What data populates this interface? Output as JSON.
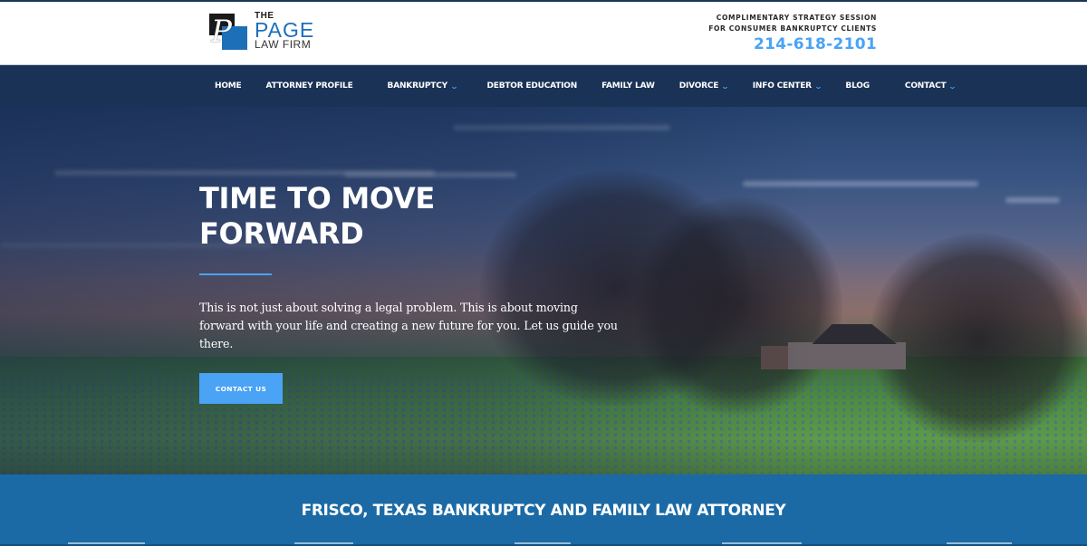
{
  "header": {
    "logo": {
      "the": "THE",
      "page": "PAGE",
      "law_firm": "LAW FIRM",
      "mark_glyph": "P",
      "name": "logo"
    },
    "promo": {
      "line1": "COMPLIMENTARY STRATEGY SESSION",
      "line2": "FOR CONSUMER BANKRUPTCY CLIENTS",
      "phone": "214-618-2101"
    }
  },
  "nav": {
    "items": [
      {
        "label": "HOME",
        "dropdown": false
      },
      {
        "label": "ATTORNEY PROFILE",
        "dropdown": false
      },
      {
        "label": "BANKRUPTCY",
        "dropdown": true
      },
      {
        "label": "DEBTOR EDUCATION",
        "dropdown": false
      },
      {
        "label": "FAMILY LAW",
        "dropdown": false
      },
      {
        "label": "DIVORCE",
        "dropdown": true
      },
      {
        "label": "INFO CENTER",
        "dropdown": true
      },
      {
        "label": "BLOG",
        "dropdown": false
      },
      {
        "label": "CONTACT",
        "dropdown": true
      }
    ],
    "chevron_glyph": "⌄"
  },
  "hero": {
    "title_line1": "TIME TO MOVE",
    "title_line2": "FORWARD",
    "text": "This is not just about solving a legal problem. This is about moving forward with your life and creating a new future for you. Let us guide you there.",
    "button_label": "CONTACT US"
  },
  "band": {
    "title": "FRISCO, TEXAS BANKRUPTCY AND FAMILY LAW ATTORNEY"
  },
  "colors": {
    "navy": "#1a3255",
    "accent_blue": "#4aa3f5",
    "band_blue": "#1b6aa5",
    "logo_blue": "#1d6fb8"
  }
}
